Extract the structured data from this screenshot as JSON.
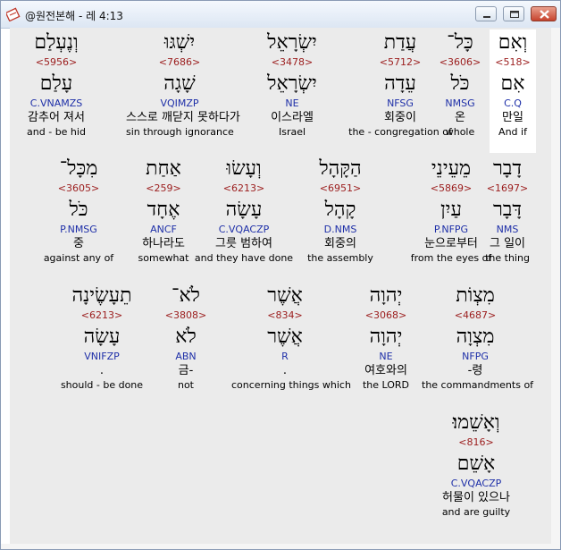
{
  "window": {
    "title": "@원전본해 - 레 4:13"
  },
  "rows": [
    [
      {
        "heb": "וְאִם",
        "strong": "<518>",
        "lemma": "אִם",
        "parse": "C.Q",
        "kor": "만일",
        "eng": "And if",
        "highlight": true
      },
      {
        "heb": "כָּל־",
        "strong": "<3606>",
        "lemma": "כֹּל",
        "parse": "NMSG",
        "kor": "온",
        "eng": "whole"
      },
      {
        "heb": "עֲדַת",
        "strong": "<5712>",
        "lemma": "עֵדָה",
        "parse": "NFSG",
        "kor": "회중이",
        "eng": "the - congregation of"
      },
      {
        "heb": "יִשְׂרָאֵל",
        "strong": "<3478>",
        "lemma": "יִשְׂרָאֵל",
        "parse": "NE",
        "kor": "이스라엘",
        "eng": "Israel"
      },
      {
        "heb": "יִשְׁגּוּ",
        "strong": "<7686>",
        "lemma": "שָׁגָה",
        "parse": "VQIMZP",
        "kor": "스스로 깨닫지 못하다가",
        "eng": "sin through ignorance"
      },
      {
        "heb": "וְנֶעְלַם",
        "strong": "<5956>",
        "lemma": "עָלַם",
        "parse": "C.VNAMZS",
        "kor": "감추어 져서",
        "eng": "and - be hid"
      }
    ],
    [
      {
        "heb": "דָבָר",
        "strong": "<1697>",
        "lemma": "דָּבָר",
        "parse": "NMS",
        "kor": "그 일이",
        "eng": "the thing"
      },
      {
        "heb": "מֵעֵינֵי",
        "strong": "<5869>",
        "lemma": "עַיִן",
        "parse": "P.NFPG",
        "kor": "눈으로부터",
        "eng": "from the eyes of"
      },
      {
        "heb": "הַקָּהָל",
        "strong": "<6951>",
        "lemma": "קָהָל",
        "parse": "D.NMS",
        "kor": "회중의",
        "eng": "the assembly"
      },
      {
        "heb": "וְעָשׂוּ",
        "strong": "<6213>",
        "lemma": "עָשָׂה",
        "parse": "C.VQACZP",
        "kor": "그릇 범하여",
        "eng": "and they have done"
      },
      {
        "heb": "אַחַת",
        "strong": "<259>",
        "lemma": "אֶחָד",
        "parse": "ANCF",
        "kor": "하나라도",
        "eng": "somewhat"
      },
      {
        "heb": "מִכָּל־",
        "strong": "<3605>",
        "lemma": "כֹּל",
        "parse": "P.NMSG",
        "kor": "중",
        "eng": "against any of"
      }
    ],
    [
      {
        "heb": "מִצְוֹת",
        "strong": "<4687>",
        "lemma": "מִצְוָה",
        "parse": "NFPG",
        "kor": "-령",
        "eng": "the commandments of"
      },
      {
        "heb": "יְהוָה",
        "strong": "<3068>",
        "lemma": "יְהוָה",
        "parse": "NE",
        "kor": "여호와의",
        "eng": "the LORD"
      },
      {
        "heb": "אֲשֶׁר",
        "strong": "<834>",
        "lemma": "אֲשֶׁר",
        "parse": "R",
        "kor": ".",
        "eng": "concerning things which"
      },
      {
        "heb": "לֹא־",
        "strong": "<3808>",
        "lemma": "לֹא",
        "parse": "ABN",
        "kor": "금-",
        "eng": "not"
      },
      {
        "heb": "תֵעָשֶׂינָה",
        "strong": "<6213>",
        "lemma": "עָשָׂה",
        "parse": "VNIFZP",
        "kor": ".",
        "eng": "should - be done"
      }
    ],
    [
      {
        "heb": "וְאָשֵׁמוּ׃",
        "strong": "<816>",
        "lemma": "אָשֵׁם",
        "parse": "C.VQACZP",
        "kor": "허물이 있으나",
        "eng": "and are guilty"
      }
    ]
  ]
}
